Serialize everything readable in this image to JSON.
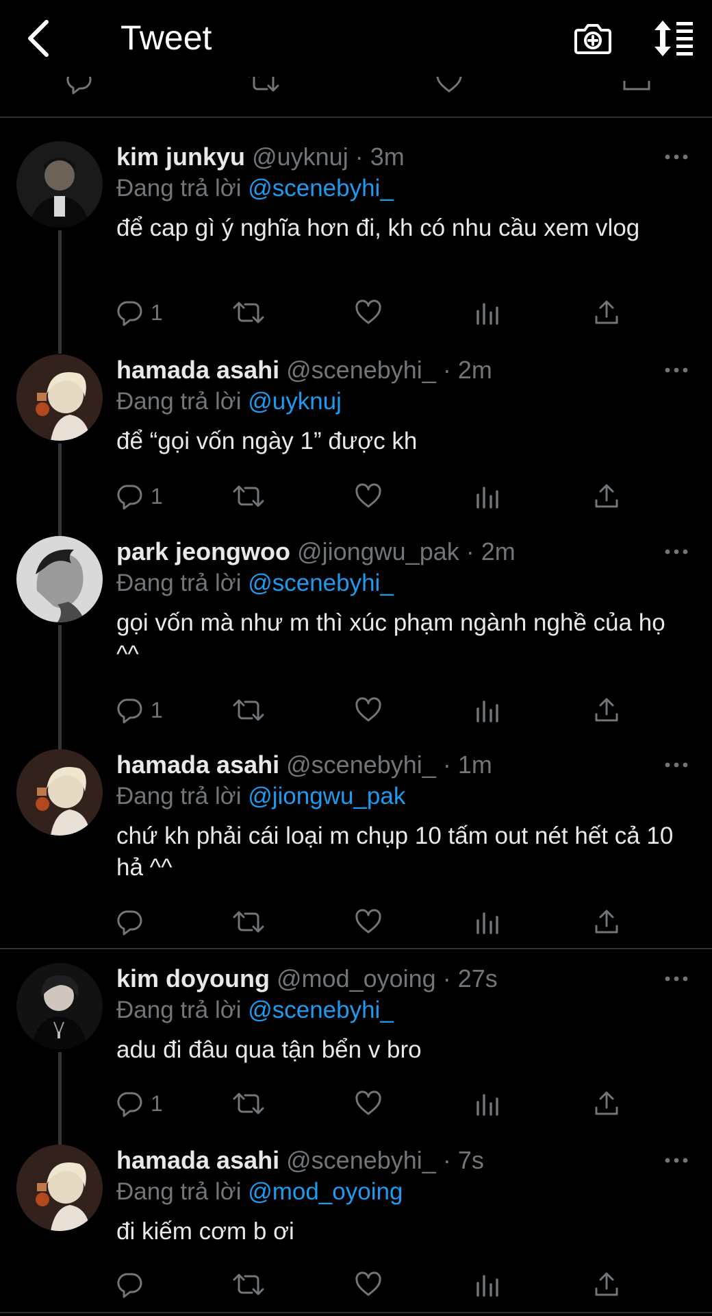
{
  "header": {
    "title": "Tweet"
  },
  "icons": {
    "back": "chevron-left-icon",
    "camera": "camera-plus-icon",
    "sort": "sort-icon",
    "reply": "reply-bubble-icon",
    "retweet": "retweet-icon",
    "like": "heart-icon",
    "views": "bar-chart-icon",
    "share": "share-upload-icon",
    "more": "more-dots-icon"
  },
  "colors": {
    "background": "#000000",
    "accent": "#1d9bf0",
    "muted": "#71767b",
    "text": "#e7e9ea",
    "divider": "#2f3336"
  },
  "replying_prefix": "Đang trả lời ",
  "replies": [
    {
      "name": "kim junkyu",
      "handle": "@uyknuj",
      "time": "3m",
      "to": "@scenebyhi_",
      "text": "để cap gì ý nghĩa hơn đi, kh có nhu cầu xem vlog",
      "reply_count": "1"
    },
    {
      "name": "hamada asahi",
      "handle": "@scenebyhi_",
      "time": "2m",
      "to": "@uyknuj",
      "text": "để “gọi vốn ngày 1” được kh",
      "reply_count": "1"
    },
    {
      "name": "park jeongwoo",
      "handle": "@jiongwu_pak",
      "time": "2m",
      "to": "@scenebyhi_",
      "text": "gọi vốn mà như m thì xúc phạm ngành nghề của họ ^^",
      "reply_count": "1"
    },
    {
      "name": "hamada asahi",
      "handle": "@scenebyhi_",
      "time": "1m",
      "to": "@jiongwu_pak",
      "text": "chứ kh phải cái loại m chụp 10 tấm out nét hết cả 10 hả ^^",
      "reply_count": ""
    },
    {
      "name": "kim doyoung",
      "handle": "@mod_oyoing",
      "time": "27s",
      "to": "@scenebyhi_",
      "text": "adu đi đâu qua tận bển v bro",
      "reply_count": "1"
    },
    {
      "name": "hamada asahi",
      "handle": "@scenebyhi_",
      "time": "7s",
      "to": "@mod_oyoing",
      "text": "đi kiếm cơm b ơi",
      "reply_count": ""
    }
  ]
}
